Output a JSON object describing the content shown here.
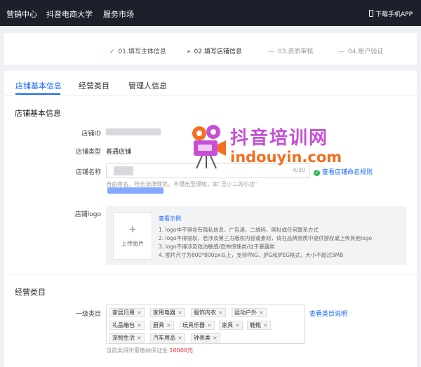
{
  "topbar": {
    "nav": [
      "营销中心",
      "抖音电商大学",
      "服务市场"
    ],
    "app_download": "下载手机APP"
  },
  "steps": [
    {
      "label": "01.填写主体信息",
      "status": "done",
      "marker": "✓"
    },
    {
      "label": "02.填写店铺信息",
      "status": "active",
      "marker": "»"
    },
    {
      "label": "03.资质审核",
      "status": "pending",
      "marker": "—"
    },
    {
      "label": "04.账户验证",
      "status": "pending",
      "marker": "—"
    }
  ],
  "tabs": [
    "店铺基本信息",
    "经营类目",
    "管理人信息"
  ],
  "basic": {
    "title": "店铺基本信息",
    "shop_id_label": "店铺ID",
    "shop_type_label": "店铺类型",
    "shop_type_value": "普通店铺",
    "shop_name_label": "店铺名称",
    "shop_name_count": "4/30",
    "naming_rules_link": "查看店铺命名规则",
    "naming_hint": "自由命名，符合法律规范，不侵出至侵权，如“王小二的小店”",
    "logo_label": "店铺logo",
    "upload_label": "上传图片",
    "example_link": "查看示例",
    "logo_rules": [
      "1. logo中不得含有隐私信息、广告语、二维码、网址或任何联系方式",
      "2. logo不得侵权，若涉及第三方版权内容或素材，请在品牌资质中提供授权或上传其他logo",
      "3. logo不得涉及政治敏感/恐怖惊悚类/过于暴露类",
      "4. 图片尺寸为800*800px以上，支持PNG、JPG和JPEG格式，大小不超过5MB"
    ]
  },
  "category": {
    "title": "经营类目",
    "level1_label": "一级类目",
    "category_link": "查看类目说明",
    "tags": [
      [
        "家居日用",
        "家用电器",
        "服饰内衣",
        "运动户外"
      ],
      [
        "礼品箱包",
        "厨具",
        "玩具乐器",
        "家具",
        "鞋靴"
      ],
      [
        "宠物生活",
        "汽车用品",
        "钟表类"
      ]
    ],
    "remove_glyph": "×",
    "deposit_text": "当前类目所需缴纳保证金",
    "deposit_amount": "10000元"
  },
  "watermark": {
    "cn": "抖音培训网",
    "en": "indouyin.com"
  },
  "colors": {
    "accent": "#1966ff",
    "success": "#35b35a",
    "topbar": "#1c202b",
    "price": "#f5222d"
  }
}
